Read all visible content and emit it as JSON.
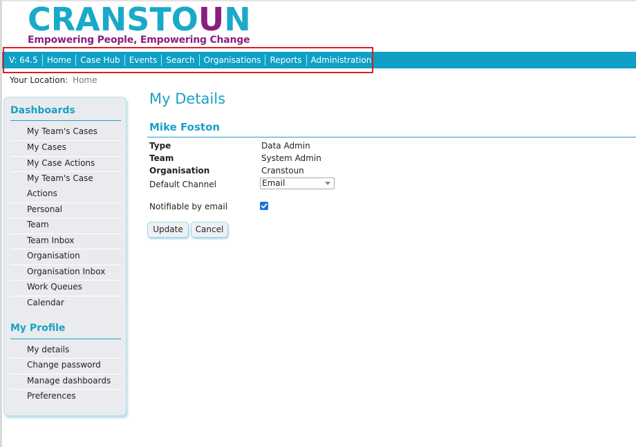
{
  "logo": {
    "main_a": "CRANSTO",
    "main_u": "U",
    "main_b": "N",
    "tagline": "Empowering People, Empowering Change"
  },
  "nav": {
    "version": "V: 64.5",
    "items": [
      "Home",
      "Case Hub",
      "Events",
      "Search",
      "Organisations",
      "Reports",
      "Administration"
    ]
  },
  "breadcrumb": {
    "label": "Your Location:",
    "current": "Home"
  },
  "sidebar": {
    "dashboards_heading": "Dashboards",
    "dashboards": [
      "My Team's Cases",
      "My Cases",
      "My Case Actions",
      "My Team's Case",
      "Actions",
      "Personal",
      "Team",
      "Team Inbox",
      "Organisation",
      "Organisation Inbox",
      "Work Queues",
      "Calendar"
    ],
    "profile_heading": "My Profile",
    "profile": [
      "My details",
      "Change password",
      "Manage dashboards",
      "Preferences"
    ]
  },
  "main": {
    "title": "My Details",
    "user_name": "Mike Foston",
    "type_label": "Type",
    "type_value": "Data Admin",
    "team_label": "Team",
    "team_value": "System Admin",
    "org_label": "Organisation",
    "org_value": "Cranstoun",
    "channel_label": "Default Channel",
    "channel_value": "Email",
    "notify_label": "Notifiable by email",
    "notify_checked": true,
    "update_label": "Update",
    "cancel_label": "Cancel"
  },
  "colors": {
    "accent": "#0fa0c6",
    "brand_purple": "#8a1f7d",
    "highlight_border": "#d62020",
    "checkbox": "#1a73d9"
  }
}
